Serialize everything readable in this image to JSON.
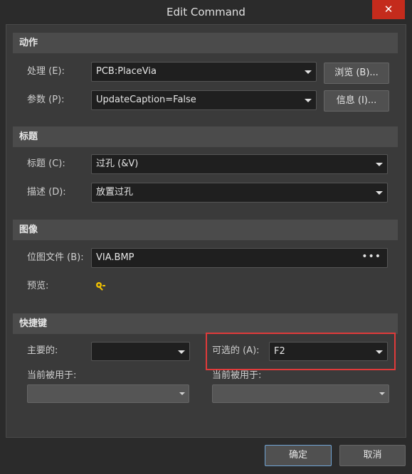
{
  "window": {
    "title": "Edit Command",
    "close_glyph": "✕"
  },
  "sections": {
    "action": "动作",
    "caption": "标题",
    "image": "图像",
    "shortcut": "快捷键"
  },
  "action": {
    "process_label": "处理 (E):",
    "process_value": "PCB:PlaceVia",
    "browse_button": "浏览 (B)...",
    "params_label": "参数 (P):",
    "params_value": "UpdateCaption=False",
    "info_button": "信息 (I)..."
  },
  "caption": {
    "title_label": "标题 (C):",
    "title_value": "过孔 (&V)",
    "desc_label": "描述 (D):",
    "desc_value": "放置过孔"
  },
  "image": {
    "bitmap_label": "位图文件 (B):",
    "bitmap_value": "VIA.BMP",
    "preview_label": "预览:",
    "preview_icon": "via-icon"
  },
  "shortcut": {
    "primary_label": "主要的:",
    "primary_value": "",
    "alternate_label": "可选的 (A):",
    "alternate_value": "F2",
    "primary_used_label": "当前被用于:",
    "alternate_used_label": "当前被用于:"
  },
  "footer": {
    "ok_button": "确定",
    "cancel_button": "取消"
  },
  "colors": {
    "highlight": "#e03a3a",
    "close_bg": "#c42b1c",
    "primary_border": "#6fa3d4"
  }
}
